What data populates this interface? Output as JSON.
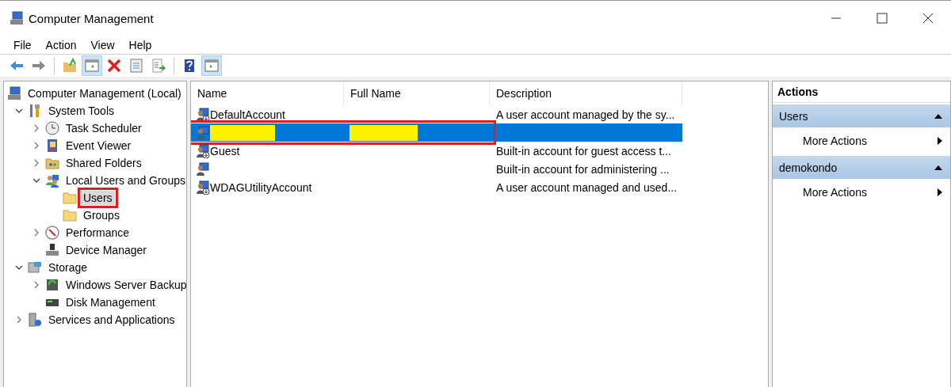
{
  "window": {
    "title": "Computer Management"
  },
  "menu": [
    "File",
    "Action",
    "View",
    "Help"
  ],
  "toolbar": [
    {
      "kind": "back",
      "pressed": false
    },
    {
      "kind": "forward",
      "pressed": false
    },
    {
      "kind": "separator"
    },
    {
      "kind": "up",
      "pressed": false
    },
    {
      "kind": "tree",
      "pressed": true
    },
    {
      "kind": "delete",
      "pressed": false
    },
    {
      "kind": "properties",
      "pressed": false
    },
    {
      "kind": "export",
      "pressed": false
    },
    {
      "kind": "separator"
    },
    {
      "kind": "help",
      "pressed": false
    },
    {
      "kind": "pane",
      "pressed": true
    }
  ],
  "tree": [
    {
      "label": "Computer Management (Local)",
      "kind": "computer",
      "selected": false,
      "children": [
        {
          "label": "System Tools",
          "kind": "tools",
          "expanded": true,
          "selected": false,
          "children": [
            {
              "label": "Task Scheduler",
              "kind": "clock",
              "expanded": false,
              "selected": false
            },
            {
              "label": "Event Viewer",
              "kind": "log",
              "expanded": false,
              "selected": false
            },
            {
              "label": "Shared Folders",
              "kind": "share",
              "expanded": false,
              "selected": false
            },
            {
              "label": "Local Users and Groups",
              "kind": "users",
              "expanded": true,
              "selected": false,
              "children": [
                {
                  "label": "Users",
                  "kind": "folder",
                  "selected": true,
                  "highlighted": true
                },
                {
                  "label": "Groups",
                  "kind": "folder",
                  "selected": false,
                  "highlighted": false
                }
              ]
            },
            {
              "label": "Performance",
              "kind": "gauge",
              "expanded": false,
              "selected": false
            },
            {
              "label": "Device Manager",
              "kind": "device",
              "selected": false
            }
          ]
        },
        {
          "label": "Storage",
          "kind": "storage",
          "expanded": true,
          "selected": false,
          "children": [
            {
              "label": "Windows Server Backup",
              "kind": "backup",
              "expanded": false,
              "selected": false
            },
            {
              "label": "Disk Management",
              "kind": "disk",
              "selected": false
            }
          ]
        },
        {
          "label": "Services and Applications",
          "kind": "services",
          "expanded": false,
          "selected": false
        }
      ]
    }
  ],
  "table": {
    "columns": [
      "Name",
      "Full Name",
      "Description"
    ],
    "rows": [
      {
        "name": "DefaultAccount",
        "description": "A user account managed by the sy...",
        "selected": false,
        "highlighted": false,
        "redacted": false,
        "kind": "disabled"
      },
      {
        "selected": true,
        "highlighted": true,
        "redacted": true,
        "kind": "enabled"
      },
      {
        "name": "Guest",
        "description": "Built-in account for guest access t...",
        "selected": false,
        "highlighted": false,
        "redacted": false,
        "kind": "disabled"
      },
      {
        "description": "Built-in account for administering ...",
        "selected": false,
        "highlighted": false,
        "redacted": false,
        "kind": "enabled"
      },
      {
        "name": "WDAGUtilityAccount",
        "description": "A user account managed and used...",
        "selected": false,
        "highlighted": false,
        "redacted": false,
        "kind": "disabled"
      }
    ]
  },
  "actions": {
    "title": "Actions",
    "sections": [
      {
        "title": "Users",
        "expanded": true,
        "items": [
          "More Actions"
        ]
      },
      {
        "title": "demokondo",
        "expanded": true,
        "items": [
          "More Actions"
        ]
      }
    ]
  }
}
